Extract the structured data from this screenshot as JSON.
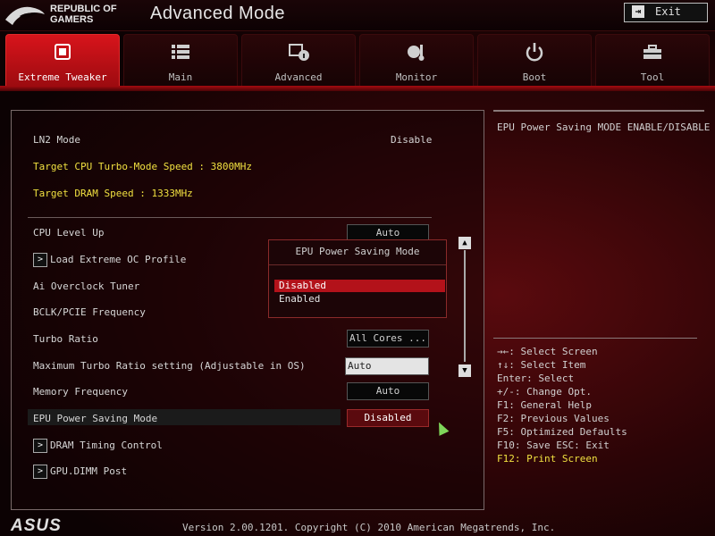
{
  "header": {
    "brand_line1": "REPUBLIC OF",
    "brand_line2": "GAMERS",
    "title": "Advanced Mode",
    "exit_label": "Exit"
  },
  "tabs": [
    {
      "label": "Extreme Tweaker",
      "icon": "ram-icon",
      "active": true
    },
    {
      "label": "Main",
      "icon": "list-icon",
      "active": false
    },
    {
      "label": "Advanced",
      "icon": "info-icon",
      "active": false
    },
    {
      "label": "Monitor",
      "icon": "temperature-icon",
      "active": false
    },
    {
      "label": "Boot",
      "icon": "power-icon",
      "active": false
    },
    {
      "label": "Tool",
      "icon": "toolbox-icon",
      "active": false
    }
  ],
  "settings": {
    "ln2_mode_label": "LN2 Mode",
    "ln2_mode_value": "Disable",
    "target_cpu": "Target CPU Turbo-Mode Speed : 3800MHz",
    "target_dram": "Target DRAM Speed : 1333MHz",
    "cpu_level_up_label": "CPU Level Up",
    "cpu_level_up_value": "Auto",
    "load_profile_label": "Load Extreme OC Profile",
    "ai_overclock_label": "Ai Overclock Tuner",
    "bclk_label": "BCLK/PCIE Frequency",
    "turbo_ratio_label": "Turbo Ratio",
    "turbo_ratio_value": "All Cores ...",
    "max_turbo_label": "Maximum Turbo Ratio setting (Adjustable in OS)",
    "max_turbo_value": "Auto",
    "memory_freq_label": "Memory Frequency",
    "memory_freq_value": "Auto",
    "epu_label": "EPU Power Saving Mode",
    "epu_value": "Disabled",
    "dram_timing_label": "DRAM Timing Control",
    "gpu_dimm_label": "GPU.DIMM Post"
  },
  "popup": {
    "title": "EPU Power Saving Mode",
    "options": [
      "Disabled",
      "Enabled"
    ],
    "selected": "Disabled"
  },
  "help": {
    "description": "EPU Power Saving MODE ENABLE/DISABLE",
    "keys": [
      "→←: Select Screen",
      "↑↓: Select Item",
      "Enter: Select",
      "+/-: Change Opt.",
      "F1: General Help",
      "F2: Previous Values",
      "F5: Optimized Defaults",
      "F10: Save  ESC: Exit",
      "F12: Print Screen"
    ]
  },
  "footer": {
    "brand": "ASUS",
    "version": "Version 2.00.1201. Copyright (C) 2010 American Megatrends, Inc."
  },
  "colors": {
    "accent": "#c8101a",
    "highlight_text": "#f0e040"
  }
}
